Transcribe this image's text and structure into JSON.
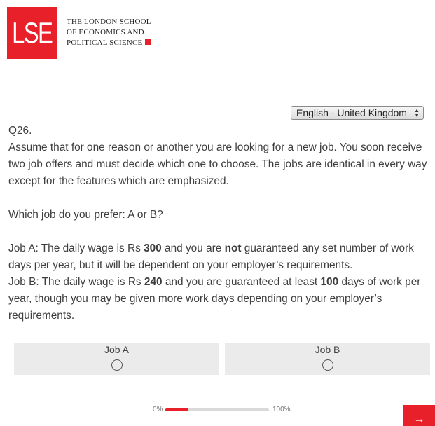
{
  "header": {
    "logo_text": "LSE",
    "school_line1": "THE LONDON SCHOOL",
    "school_line2": "OF ECONOMICS AND",
    "school_line3": "POLITICAL SCIENCE"
  },
  "language_select": {
    "value": "English - United Kingdom",
    "arrows": "▲▼"
  },
  "question": {
    "number": "Q26.",
    "intro": "Assume that for one reason or another you are looking for a new job. You soon receive two job offers and must decide which one to choose. The jobs are identical in every way except for the features which are emphasized.",
    "prompt": "Which job do you prefer: A or B?",
    "job_a": {
      "prefix": "Job A: The daily wage is Rs ",
      "wage": "300",
      "mid": " and you are ",
      "emph": "not",
      "suffix": " guaranteed any set number of work days per year, but it will be dependent on your employer’s requirements."
    },
    "job_b": {
      "prefix": "Job B: The daily wage is Rs ",
      "wage": "240",
      "mid": " and you are guaranteed at least ",
      "days": "100",
      "suffix": " days of work per year, though you may be given more work days depending on your employer’s requirements."
    }
  },
  "choices": [
    {
      "label": "Job A"
    },
    {
      "label": "Job B"
    }
  ],
  "progress": {
    "start_label": "0%",
    "end_label": "100%",
    "fraction": 0.22
  },
  "next_button": {
    "label": "→"
  },
  "colors": {
    "accent": "#e8202a",
    "choice_bg": "#ebebeb"
  }
}
